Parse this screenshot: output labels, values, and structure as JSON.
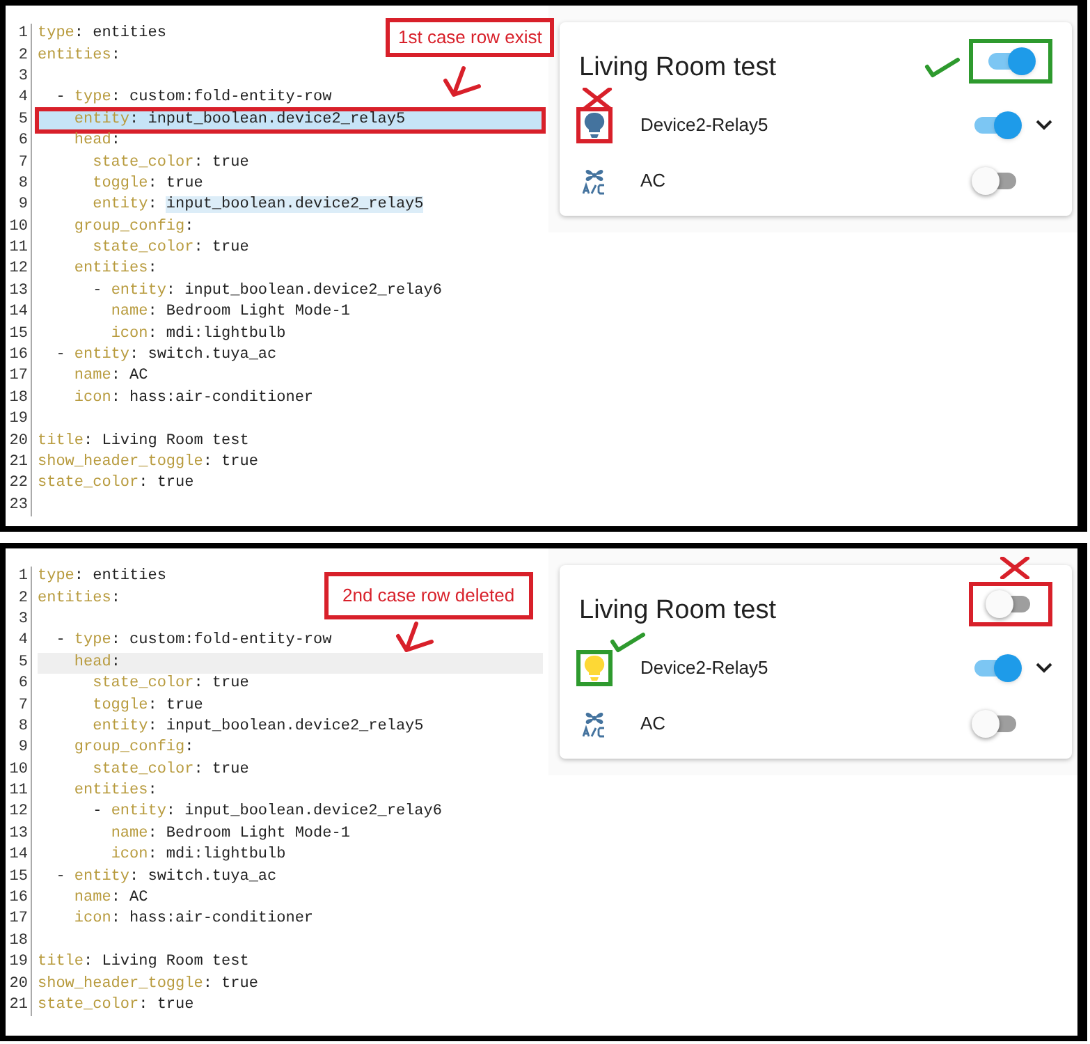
{
  "panels": [
    {
      "note": {
        "text": "1st case row exist"
      },
      "code_lines": [
        {
          "number": "1",
          "text": "type: entities",
          "selected": false
        },
        {
          "number": "2",
          "text": "entities:",
          "selected": false
        },
        {
          "number": "3",
          "selected": false
        },
        {
          "number": "4",
          "text": "  - type: custom:fold-entity-row",
          "selected": false
        },
        {
          "number": "5",
          "text": "    entity: input_boolean.device2_relay5",
          "selected": true,
          "boxed": true
        },
        {
          "number": "6",
          "text": "    head:",
          "selected": false
        },
        {
          "number": "7",
          "text": "      state_color: true",
          "selected": false
        },
        {
          "number": "8",
          "text": "      toggle: true",
          "selected": false
        },
        {
          "number": "9",
          "text": "      entity: input_boolean.device2_relay5",
          "selected": false,
          "match_highlight": true
        },
        {
          "number": "10",
          "text": "    group_config:",
          "selected": false
        },
        {
          "number": "11",
          "text": "      state_color: true",
          "selected": false
        },
        {
          "number": "12",
          "text": "    entities:",
          "selected": false
        },
        {
          "number": "13",
          "text": "      - entity: input_boolean.device2_relay6",
          "selected": false
        },
        {
          "number": "14",
          "text": "        name: Bedroom Light Mode-1",
          "selected": false
        },
        {
          "number": "15",
          "text": "        icon: mdi:lightbulb",
          "selected": false
        },
        {
          "number": "16",
          "text": "  - entity: switch.tuya_ac",
          "selected": false
        },
        {
          "number": "17",
          "text": "    name: AC",
          "selected": false
        },
        {
          "number": "18",
          "text": "    icon: hass:air-conditioner",
          "selected": false
        },
        {
          "number": "19",
          "selected": false
        },
        {
          "number": "20",
          "text": "title: Living Room test",
          "selected": false
        },
        {
          "number": "21",
          "text": "show_header_toggle: true",
          "selected": false
        },
        {
          "number": "22",
          "text": "state_color: true",
          "selected": false
        },
        {
          "number": "23",
          "selected": false
        }
      ],
      "card": {
        "title": "Living Room test",
        "header_toggle": {
          "on": true,
          "annotation": {
            "kind": "check"
          }
        },
        "rows": [
          {
            "kind": "fold",
            "icon_active": false,
            "name": "Device2-Relay5",
            "on": true,
            "annotation": {
              "kind": "cross"
            }
          },
          {
            "kind": "switch",
            "name": "AC",
            "on": false
          }
        ]
      }
    },
    {
      "note": {
        "text": "2nd case row deleted"
      },
      "code_lines": [
        {
          "number": "1",
          "text": "type: entities",
          "selected": false
        },
        {
          "number": "2",
          "text": "entities:",
          "selected": false
        },
        {
          "number": "3",
          "selected": false
        },
        {
          "number": "4",
          "text": "  - type: custom:fold-entity-row",
          "selected": false
        },
        {
          "number": "5",
          "text": "    head:",
          "selected": false,
          "current": true
        },
        {
          "number": "6",
          "text": "      state_color: true",
          "selected": false
        },
        {
          "number": "7",
          "text": "      toggle: true",
          "selected": false
        },
        {
          "number": "8",
          "text": "      entity: input_boolean.device2_relay5",
          "selected": false
        },
        {
          "number": "9",
          "text": "    group_config:",
          "selected": false
        },
        {
          "number": "10",
          "text": "      state_color: true",
          "selected": false
        },
        {
          "number": "11",
          "text": "    entities:",
          "selected": false
        },
        {
          "number": "12",
          "text": "      - entity: input_boolean.device2_relay6",
          "selected": false
        },
        {
          "number": "13",
          "text": "        name: Bedroom Light Mode-1",
          "selected": false
        },
        {
          "number": "14",
          "text": "        icon: mdi:lightbulb",
          "selected": false
        },
        {
          "number": "15",
          "text": "  - entity: switch.tuya_ac",
          "selected": false
        },
        {
          "number": "16",
          "text": "    name: AC",
          "selected": false
        },
        {
          "number": "17",
          "text": "    icon: hass:air-conditioner",
          "selected": false
        },
        {
          "number": "18",
          "selected": false
        },
        {
          "number": "19",
          "text": "title: Living Room test",
          "selected": false
        },
        {
          "number": "20",
          "text": "show_header_toggle: true",
          "selected": false
        },
        {
          "number": "21",
          "text": "state_color: true",
          "selected": false
        }
      ],
      "card": {
        "title": "Living Room test",
        "header_toggle": {
          "on": false,
          "annotation": {
            "kind": "cross"
          }
        },
        "rows": [
          {
            "kind": "fold",
            "icon_active": true,
            "name": "Device2-Relay5",
            "on": true,
            "annotation": {
              "kind": "check"
            }
          },
          {
            "kind": "switch",
            "name": "AC",
            "on": false
          }
        ]
      }
    }
  ]
}
